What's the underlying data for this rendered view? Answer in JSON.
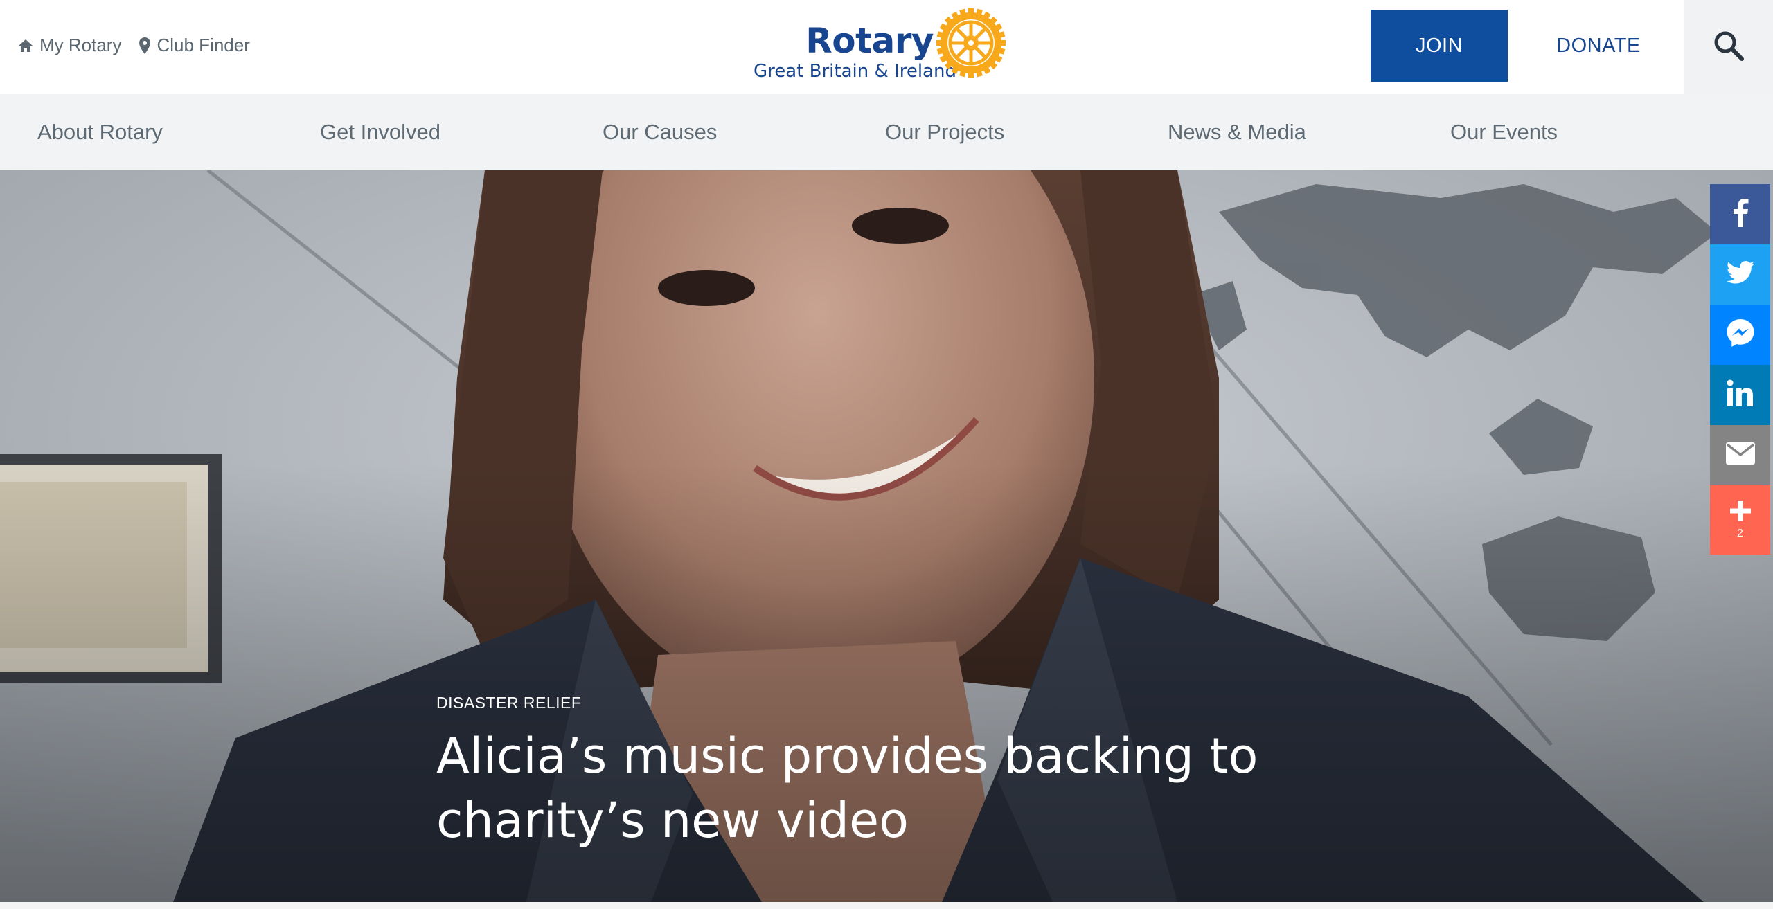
{
  "header": {
    "util_links": [
      {
        "label": "My Rotary",
        "icon": "home-icon"
      },
      {
        "label": "Club Finder",
        "icon": "map-pin-icon"
      }
    ],
    "logo": {
      "wordmark": "Rotary",
      "subtitle": "Great Britain & Ireland",
      "wheel_icon": "rotary-wheel-icon"
    },
    "join_label": "JOIN",
    "donate_label": "DONATE",
    "search_icon": "search-icon"
  },
  "nav": {
    "items": [
      {
        "label": "About Rotary"
      },
      {
        "label": "Get Involved"
      },
      {
        "label": "Our Causes"
      },
      {
        "label": "Our Projects"
      },
      {
        "label": "News & Media"
      },
      {
        "label": "Our Events"
      }
    ]
  },
  "hero": {
    "kicker": "DISASTER RELIEF",
    "title": "Alicia’s music provides backing to charity’s new video"
  },
  "share": {
    "buttons": [
      {
        "network": "facebook",
        "icon": "facebook-icon",
        "color": "#3b5998"
      },
      {
        "network": "twitter",
        "icon": "twitter-icon",
        "color": "#1da1f2"
      },
      {
        "network": "messenger",
        "icon": "messenger-icon",
        "color": "#0084ff"
      },
      {
        "network": "linkedin",
        "icon": "linkedin-icon",
        "color": "#007bb5"
      },
      {
        "network": "email",
        "icon": "email-icon",
        "color": "#848484"
      },
      {
        "network": "more",
        "icon": "plus-icon",
        "color": "#ff6550",
        "count": "2"
      }
    ]
  },
  "colors": {
    "brand_blue": "#17458f",
    "join_blue": "#0f4d9f",
    "rotary_gold": "#f7a81b",
    "nav_bg": "#f2f3f4",
    "nav_text": "#5d6a74"
  }
}
